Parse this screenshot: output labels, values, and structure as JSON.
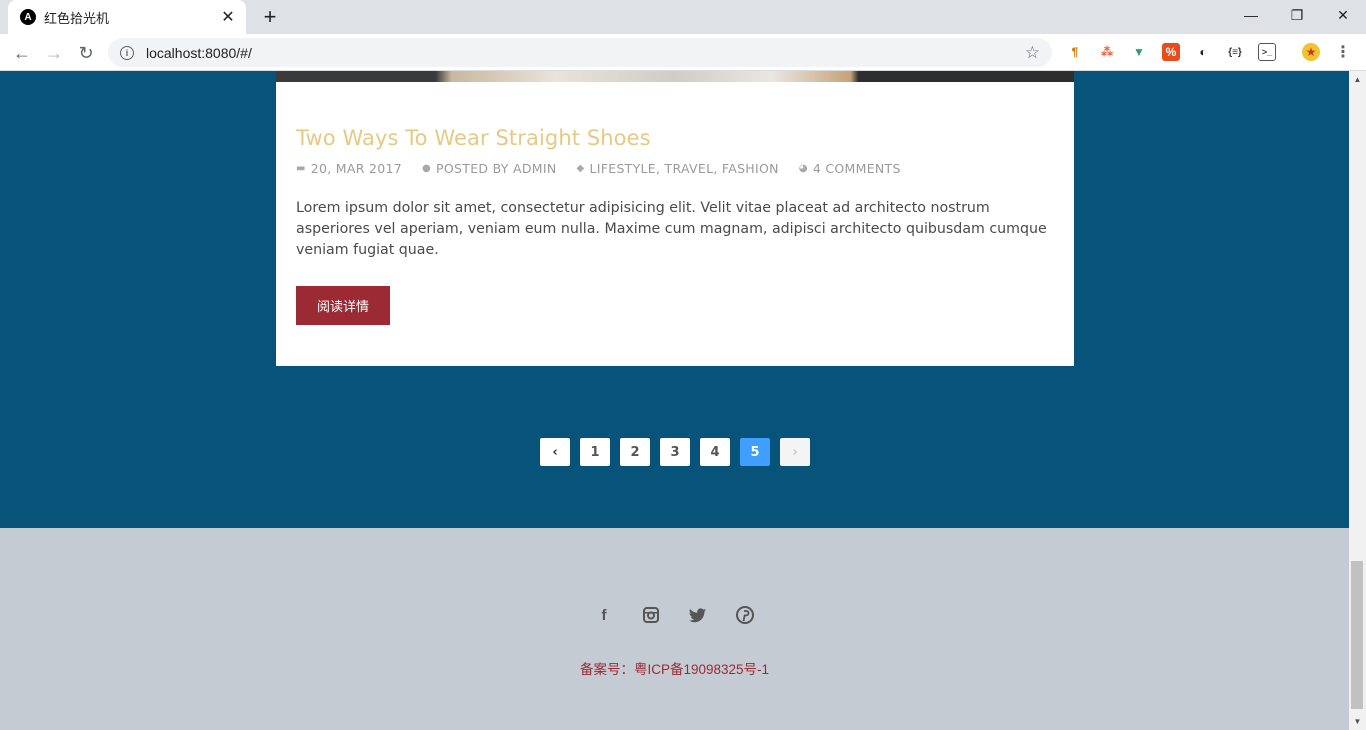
{
  "browser": {
    "tab_title": "红色拾光机",
    "favicon_letter": "A",
    "url": "localhost:8080/#/",
    "extensions": [
      "paragraph-ext",
      "network-ext",
      "vue-devtools",
      "coupon-ext",
      "circle-ext",
      "json-ext",
      "terminal-ext",
      "profile-ext"
    ]
  },
  "post": {
    "title": "Two Ways To Wear Straight Shoes",
    "date": "20, MAR 2017",
    "author": "POSTED BY ADMIN",
    "categories": "LIFESTYLE, TRAVEL, FASHION",
    "comments": "4 COMMENTS",
    "excerpt": "Lorem ipsum dolor sit amet, consectetur adipisicing elit. Velit vitae placeat ad architecto nostrum asperiores vel aperiam, veniam eum nulla. Maxime cum magnam, adipisci architecto quibusdam cumque veniam fugiat quae.",
    "read_more_label": "阅读详情"
  },
  "pagination": {
    "pages": [
      "1",
      "2",
      "3",
      "4",
      "5"
    ],
    "current": "5"
  },
  "footer": {
    "icp": "备案号：粤ICP备19098325号-1"
  },
  "colors": {
    "section_bg": "#07537a",
    "title": "#e6c983",
    "button": "#9b2a34",
    "active_page": "#409eff",
    "footer_bg": "#c5cbd3"
  }
}
